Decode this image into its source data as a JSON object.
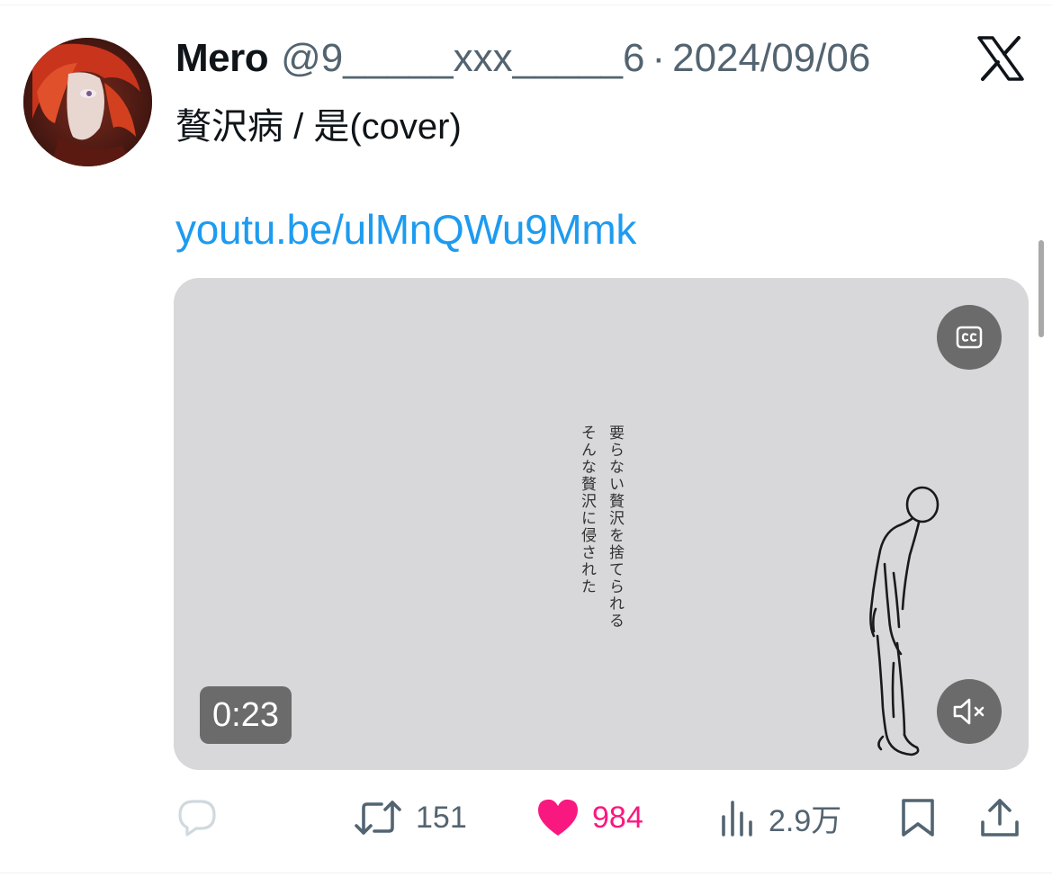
{
  "tweet": {
    "author_name": "Mero",
    "handle": "@9_____xxx_____6",
    "separator": "·",
    "date": "2024/09/06",
    "text": "贅沢病 / 是(cover)",
    "link": "youtu.be/ulMnQWu9Mmk"
  },
  "media": {
    "lyric_lines": [
      "要らない贅沢を捨てられる",
      "そんな贅沢に侵された"
    ],
    "timestamp": "0:23"
  },
  "actions": {
    "retweet_count": "151",
    "like_count": "984",
    "views_count": "2.9万"
  },
  "colors": {
    "link": "#1d9bf0",
    "like": "#f91880",
    "muted_text": "#536471",
    "media_bg": "#d8d8da"
  },
  "icons": {
    "brand": "x-logo-icon",
    "reply": "reply-icon",
    "retweet": "retweet-icon",
    "like": "heart-icon",
    "views": "views-icon",
    "bookmark": "bookmark-icon",
    "share": "share-icon",
    "captions": "cc-icon",
    "mute": "muted-speaker-icon"
  }
}
